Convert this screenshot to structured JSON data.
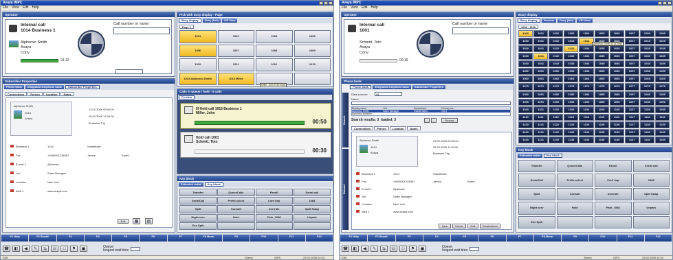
{
  "window_title": "Avaya IMPC",
  "menu": [
    "File",
    "View",
    "Edit",
    "Help"
  ],
  "left": {
    "operator": {
      "header": "Operator",
      "call_title": "Internal call",
      "call_detail": "1014 Business 1",
      "caller_name": "Alphonso Smith",
      "caller_org": "Avaya",
      "status": "Conv",
      "timer": "01:12",
      "call_input_placeholder": "Call number or name"
    },
    "pd_header": "Pick with busy display - Page",
    "pd_tabs": [
      "Busy display",
      "Deny (Not)",
      "VIP View"
    ],
    "page_tab": "Page 1",
    "keys": [
      {
        "label": "1001",
        "state": "busy"
      },
      {
        "label": "1002",
        "state": "free"
      },
      {
        "label": "1004",
        "state": "free"
      },
      {
        "label": "1005",
        "state": "free"
      },
      {
        "label": "1006",
        "state": "busy"
      },
      {
        "label": "1007",
        "state": "free"
      },
      {
        "label": "1008",
        "state": "free"
      },
      {
        "label": "1009",
        "state": "free"
      },
      {
        "label": "1010",
        "state": "free"
      },
      {
        "label": "1011",
        "state": "free"
      },
      {
        "label": "1012",
        "state": "free"
      },
      {
        "label": "1013",
        "state": "free"
      },
      {
        "label": "1014 Alphonso Smith",
        "state": "busy"
      },
      {
        "label": "1015 Miller",
        "state": "busy"
      },
      {
        "label": "",
        "state": "free"
      },
      {
        "label": "",
        "state": "free"
      }
    ],
    "key_tooltip": "Miller, John 1015 Busy",
    "subscriber_header": "Subscriber Properties",
    "sub_tabs": [
      "Phone book",
      "Integrated telephone book",
      "Subscriber Properties"
    ],
    "detail_tabs": [
      "Connections",
      "Person",
      "Location",
      "Notes"
    ],
    "contact": {
      "name": "Alphonso Smith",
      "ext": "1014",
      "org": "Avaya",
      "date1": "23.02.2009 09:00:00",
      "date2": "26.02.2009 17:00:00",
      "note": "Business Trip"
    },
    "fields": [
      {
        "k": "Business 1",
        "v": "1014",
        "k2": "Substitutes",
        "v2": ""
      },
      {
        "k": "Fax",
        "v": "+4900001234567",
        "k2": "James",
        "v2": "Karen"
      },
      {
        "k": "E-mail 1",
        "v": "Alphonso",
        "k2": "",
        "v2": ""
      },
      {
        "k": "Job",
        "v": "Sales Manager",
        "k2": "",
        "v2": ""
      },
      {
        "k": "Location",
        "v": "New York",
        "k2": "",
        "v2": ""
      },
      {
        "k": "Web 1",
        "v": "www.avaya.com",
        "k2": "",
        "v2": ""
      }
    ],
    "sub_btn": "Edit",
    "cw_header": "Calls in queue / hold - 0 calls",
    "preview_tab": "Preview",
    "notif": [
      {
        "title": "Ill Hold call 1015 Business 1",
        "sub": "Miller, John",
        "time": "00:50",
        "hold": false
      },
      {
        "title": "Hold call 1001",
        "sub": "Schmitt, Toto",
        "time": "00:30",
        "hold": true
      }
    ],
    "keyblock_header": "Key block",
    "kb_tabs": [
      "Extended redial",
      "Key block"
    ],
    "kb_keys": [
      "Transfer",
      "QueueCalls",
      "Recall",
      "Serial call",
      "SerialCall",
      "Prefix select",
      "Conf dep",
      "1068",
      "Split",
      "Consult",
      "override",
      "Split Swap",
      "Night serv",
      "Hold",
      "Park_1068",
      "Unpark",
      "Exe Split",
      "",
      "",
      ""
    ],
    "fkeys": [
      "F1 Help",
      "F2 Recall",
      "F3",
      "F4",
      "F5",
      "F6",
      "F7",
      "F8 Menu",
      "F9",
      "F10",
      "F11",
      "F12"
    ],
    "queue_label": "Queue",
    "queue_label2": "longest wait time",
    "status_left": "Edit",
    "status_user": "Sirena",
    "status_mid": "OIPC",
    "status_time": "23.02.2009 14:24"
  },
  "right": {
    "operator": {
      "header": "Operator",
      "call_title": "Internal call",
      "call_detail": "1001",
      "caller_name": "Schmitt, Toto",
      "caller_org": "Avaya",
      "status": "Conv",
      "timer": "00:16",
      "call_input_placeholder": "Call number or name"
    },
    "bd_header": "Busy display",
    "bd_tabs": [
      "Busy display",
      "Preview",
      "Deny (Not)",
      "VIP View"
    ],
    "range_tab": "1000 - 1199",
    "bd_rows": 15,
    "bd_cols": 10,
    "bd_start": 1000,
    "bd_busy": [
      0,
      14,
      23,
      31
    ],
    "bd_tooltip": "Alphonso Smith 1014 Busy",
    "phonebook_header": "Phone book",
    "pb_tabs": [
      "Phone book",
      "Integrated telephone book",
      "Subscriber Properties"
    ],
    "pb_label_db": "Data sources",
    "pb_label_all": "All",
    "pb_label_name": "Name",
    "pb_cols": [
      "Display name",
      "Job",
      "Department",
      "Primary na..."
    ],
    "pb_row1": [
      "Alphonso Smith",
      "Sales Manager",
      "Global Sales",
      "1014"
    ],
    "pb_row2": [
      "Alphonso Winkelm..",
      "",
      "",
      ""
    ],
    "search_results": "Search results: 3",
    "loaded": "loaded: 3",
    "reload_btn": "Reload",
    "detail_tabs": [
      "Connections",
      "Person",
      "Location",
      "Notes"
    ],
    "contact": {
      "name": "Alphonso Smith",
      "ext": "1014",
      "org": "Avaya",
      "date1": "23.02.2009 09:00:00",
      "date2": "26.02.2009 11:00:00",
      "note": "Business Trip"
    },
    "fields": [
      {
        "k": "Business 1",
        "v": "1014",
        "k2": "Substitutes",
        "v2": ""
      },
      {
        "k": "Fax",
        "v": "+4900001234567",
        "k2": "James",
        "v2": "Karen"
      },
      {
        "k": "E-mail 1",
        "v": "Alphonso",
        "k2": "",
        "v2": ""
      },
      {
        "k": "Job",
        "v": "Sales Manager",
        "k2": "",
        "v2": ""
      },
      {
        "k": "Location",
        "v": "New York",
        "k2": "",
        "v2": ""
      },
      {
        "k": "Web 1",
        "v": "www.avaya.com",
        "k2": "",
        "v2": ""
      }
    ],
    "pb_btns": [
      "New",
      "Delete",
      "Edit",
      "Destinations"
    ],
    "side_label": "Search",
    "side_label2": "Dataset",
    "keyblock_header": "Key block",
    "kb_tabs": [
      "Extended redial",
      "Key block"
    ],
    "kb_keys": [
      "Transfer",
      "QueueCalls",
      "Recall",
      "Serial call",
      "SerialCall",
      "Prefix select",
      "Conf dep",
      "1068",
      "Split",
      "Consult",
      "override",
      "Split Swap",
      "Night serv",
      "Hold",
      "Park_1068",
      "Unpark",
      "Exe Split",
      "",
      "",
      ""
    ],
    "fkeys": [
      "F1 Help",
      "F2 Recall",
      "F3",
      "F4",
      "F5",
      "F6",
      "F7",
      "F8 Menu",
      "F9",
      "F10",
      "F11",
      "F12"
    ],
    "queue_label": "Queue",
    "queue_label2": "longest wait time",
    "status_left": "Edit",
    "status_user": "Sirena",
    "status_mid": "OIPC",
    "status_time": "23.02.2009 14:24"
  },
  "colors": {
    "title_blue": "#0e3a9c",
    "busy_yellow": "#f0b820",
    "green": "#3faa3f"
  }
}
